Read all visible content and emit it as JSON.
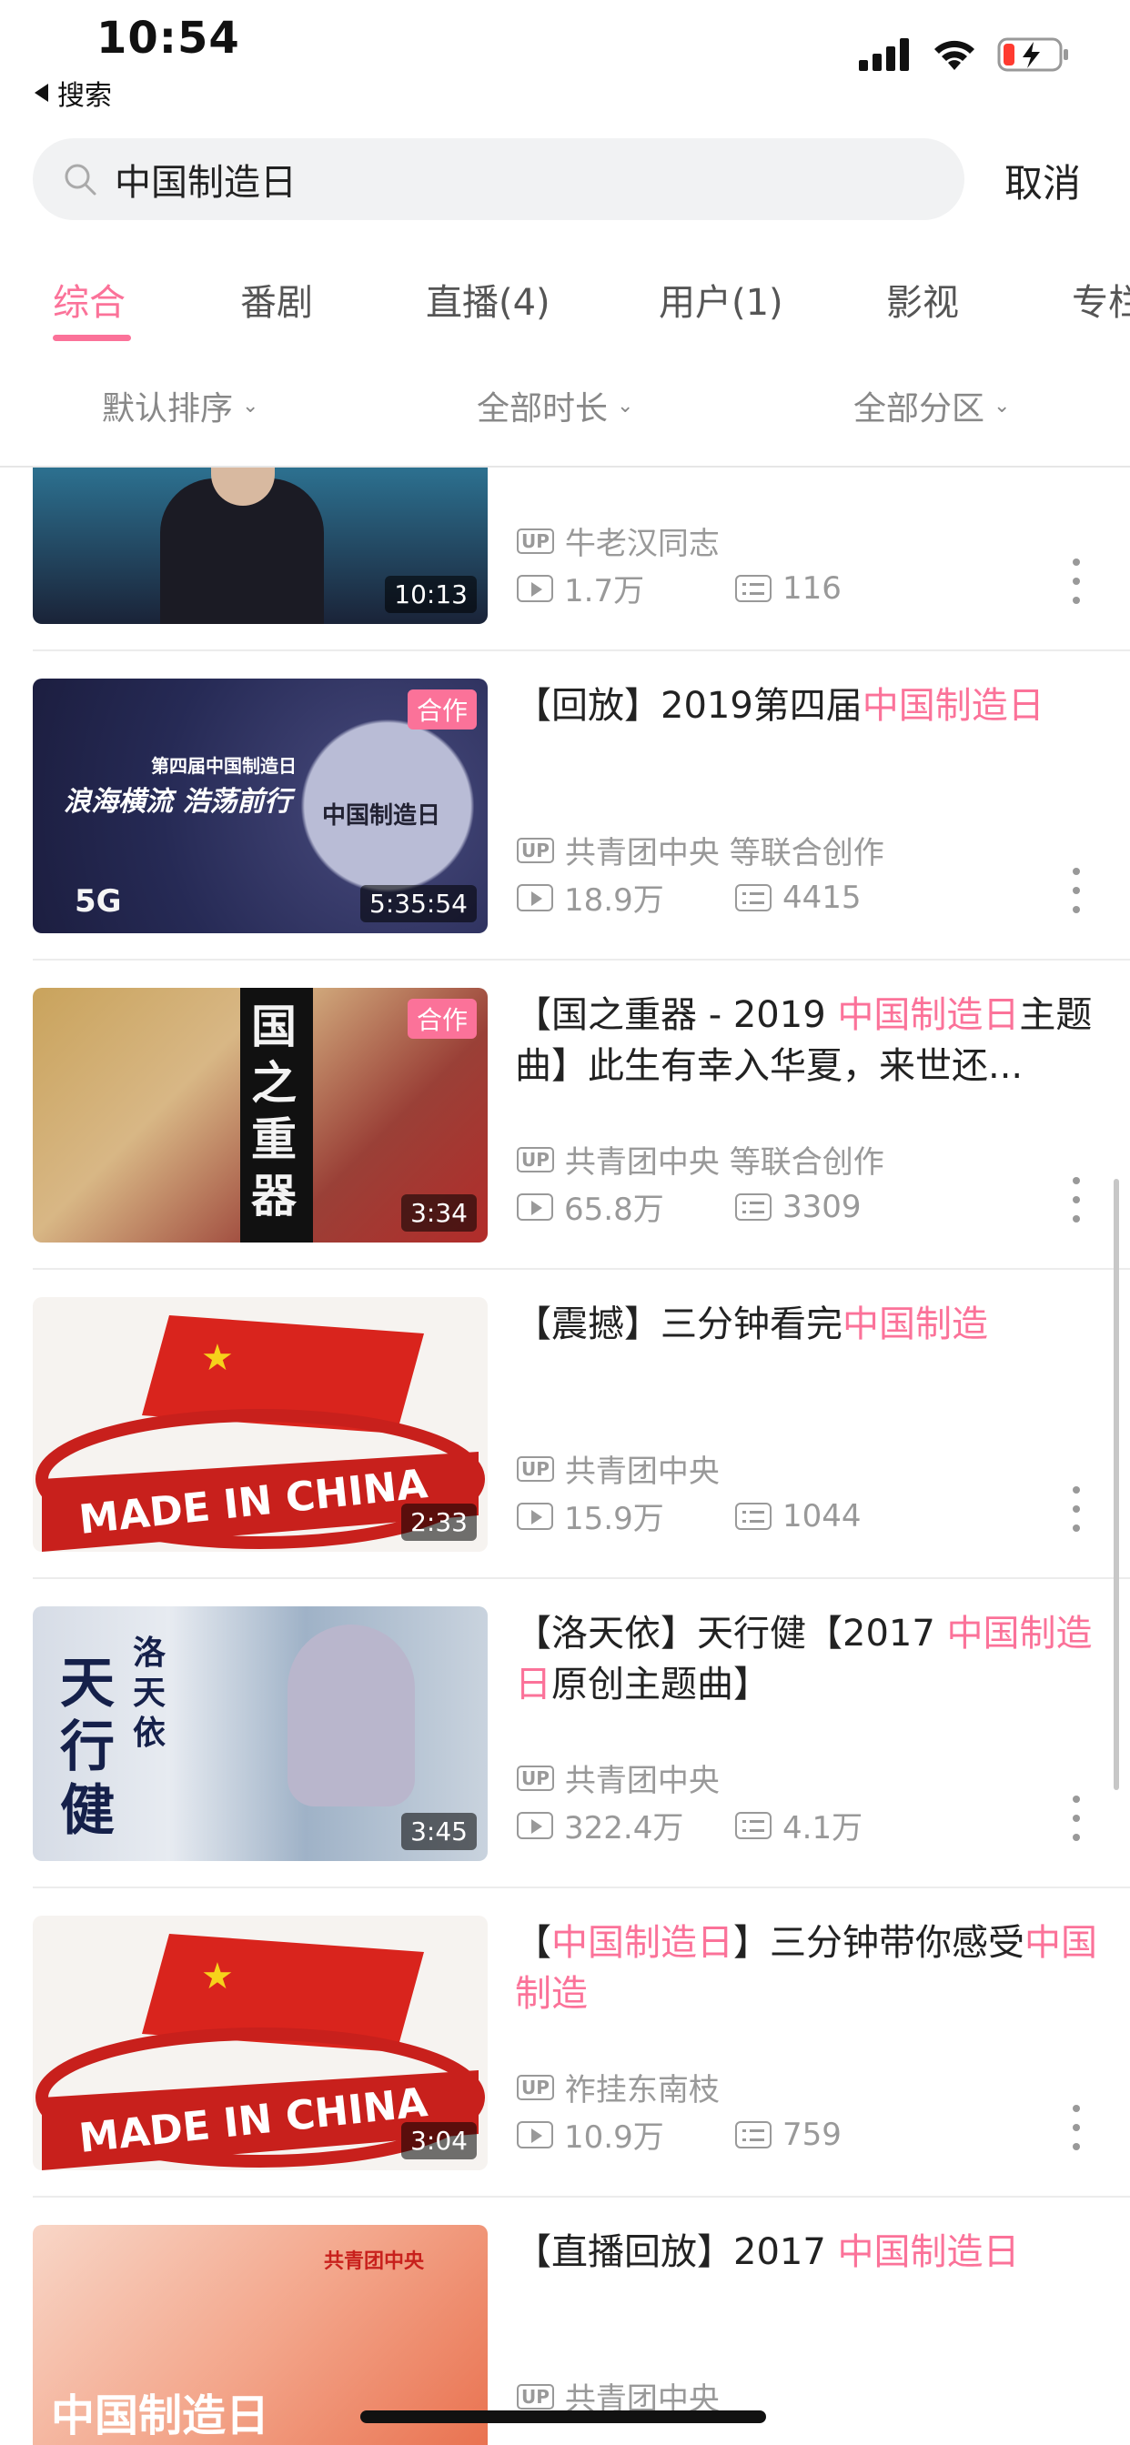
{
  "status_bar": {
    "time": "10:54",
    "back_label": "搜索"
  },
  "search": {
    "query": "中国制造日",
    "cancel_label": "取消"
  },
  "tabs": [
    {
      "label": "综合",
      "active": true
    },
    {
      "label": "番剧"
    },
    {
      "label": "直播(4)"
    },
    {
      "label": "用户(1)"
    },
    {
      "label": "影视"
    },
    {
      "label": "专栏"
    }
  ],
  "filters": [
    "默认排序",
    "全部时长",
    "全部分区"
  ],
  "colors": {
    "accent": "#fb7299",
    "meta": "#999999"
  },
  "items": [
    {
      "title_parts": [],
      "uploader": "牛老汉同志",
      "views": "1.7万",
      "danmaku": "116",
      "duration": "10:13",
      "coop": ""
    },
    {
      "title_parts": [
        {
          "t": "【回放】2019第四届",
          "hl": false
        },
        {
          "t": "中国制造日",
          "hl": true
        }
      ],
      "uploader": "共青团中央 等联合创作",
      "views": "18.9万",
      "danmaku": "4415",
      "duration": "5:35:54",
      "coop": "合作",
      "thumb_text": [
        "第四届中国制造日",
        "浪海横流 浩荡前行",
        "中国制造日",
        "5G"
      ]
    },
    {
      "title_parts": [
        {
          "t": "【国之重器 - 2019 ",
          "hl": false
        },
        {
          "t": "中国制造日",
          "hl": true
        },
        {
          "t": "主题曲】此生有幸入华夏，来世还...",
          "hl": false
        }
      ],
      "uploader": "共青团中央 等联合创作",
      "views": "65.8万",
      "danmaku": "3309",
      "duration": "3:34",
      "coop": "合作",
      "thumb_text": [
        "国之重器"
      ]
    },
    {
      "title_parts": [
        {
          "t": "【震撼】三分钟看完",
          "hl": false
        },
        {
          "t": "中国制造",
          "hl": true
        }
      ],
      "uploader": "共青团中央",
      "views": "15.9万",
      "danmaku": "1044",
      "duration": "2:33",
      "coop": "",
      "thumb_text": [
        "MADE IN CHINA"
      ]
    },
    {
      "title_parts": [
        {
          "t": "【洛天依】天行健【2017 ",
          "hl": false
        },
        {
          "t": "中国制造日",
          "hl": true
        },
        {
          "t": "原创主题曲】",
          "hl": false
        }
      ],
      "uploader": "共青团中央",
      "views": "322.4万",
      "danmaku": "4.1万",
      "duration": "3:45",
      "coop": "",
      "thumb_text": [
        "天行健",
        "洛天依"
      ]
    },
    {
      "title_parts": [
        {
          "t": "【",
          "hl": false
        },
        {
          "t": "中国制造日",
          "hl": true
        },
        {
          "t": "】三分钟带你感受",
          "hl": false
        },
        {
          "t": "中国制造",
          "hl": true
        }
      ],
      "uploader": "祚挂东南枝",
      "views": "10.9万",
      "danmaku": "759",
      "duration": "3:04",
      "coop": "",
      "thumb_text": [
        "MADE IN CHINA"
      ]
    },
    {
      "title_parts": [
        {
          "t": "【直播回放】2017 ",
          "hl": false
        },
        {
          "t": "中国制造日",
          "hl": true
        }
      ],
      "uploader": "共青团中央",
      "views": "",
      "danmaku": "",
      "duration": "",
      "coop": "",
      "thumb_text": [
        "中国制造日",
        "共青团中央"
      ]
    }
  ]
}
